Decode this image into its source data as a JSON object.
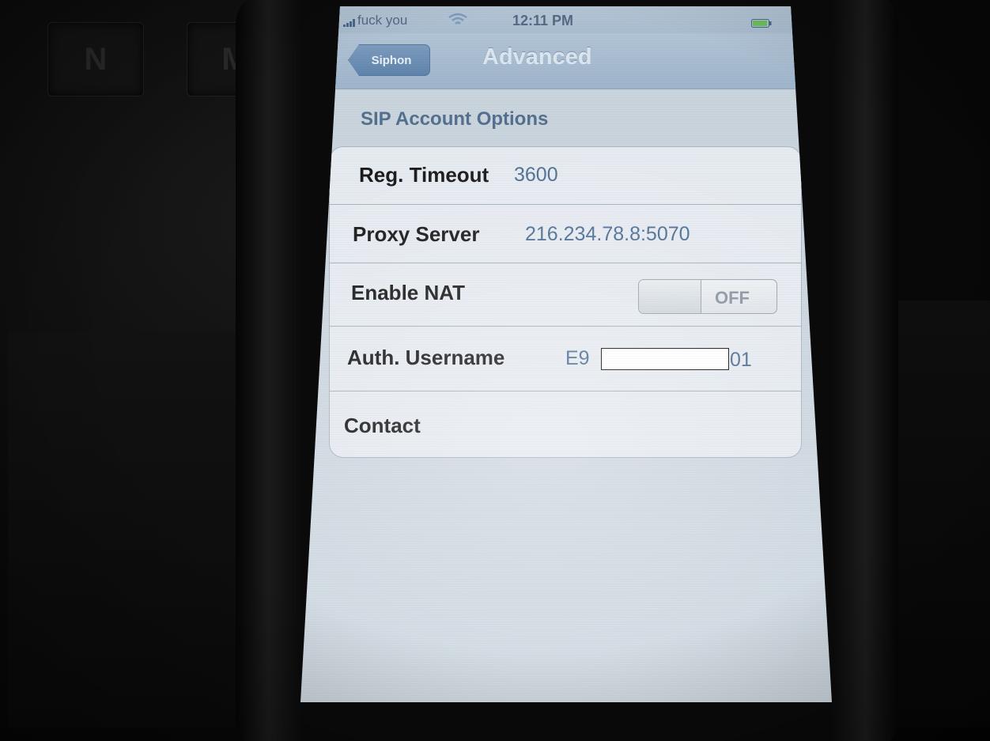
{
  "status_bar": {
    "carrier": "fuck you",
    "time": "12:11 PM"
  },
  "nav": {
    "back_label": "Siphon",
    "title": "Advanced"
  },
  "section": {
    "title": "SIP Account Options"
  },
  "rows": {
    "reg_timeout": {
      "label": "Reg. Timeout",
      "value": "3600"
    },
    "proxy_server": {
      "label": "Proxy Server",
      "value": "216.234.78.8:5070"
    },
    "enable_nat": {
      "label": "Enable NAT",
      "state": "OFF"
    },
    "auth_username": {
      "label": "Auth. Username",
      "value_prefix": "E9",
      "value_suffix": "01"
    },
    "contact": {
      "label": "Contact"
    }
  },
  "background_keys": [
    "N",
    "M"
  ],
  "colors": {
    "screen_background": "#ccd6df",
    "nav_bar": "#a9bdd0",
    "back_button": "#6a8db4",
    "value_text": "#4e6f94",
    "section_header": "#55708f"
  }
}
